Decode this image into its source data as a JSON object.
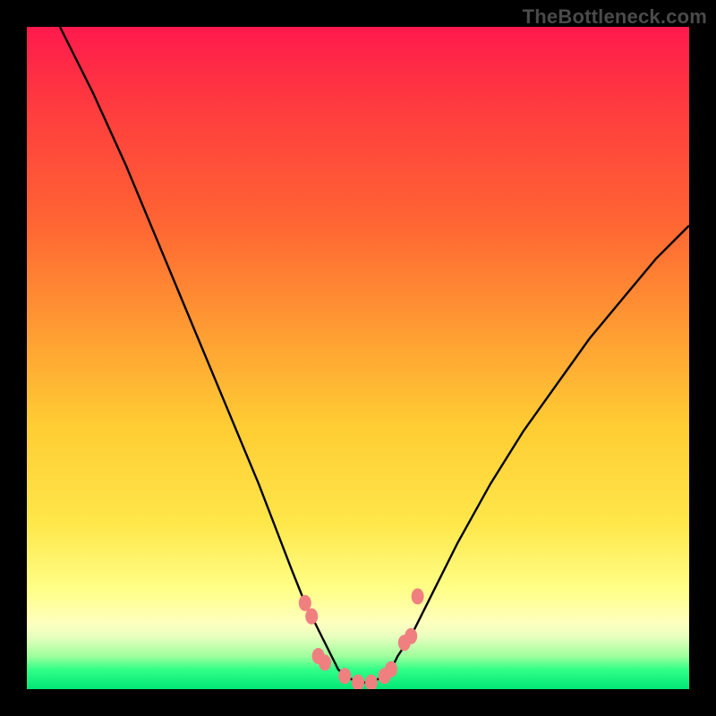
{
  "watermark": "TheBottleneck.com",
  "chart_data": {
    "type": "line",
    "title": "",
    "xlabel": "",
    "ylabel": "",
    "xlim": [
      0,
      100
    ],
    "ylim": [
      0,
      100
    ],
    "background_gradient": {
      "top_color": "#ff1a4d",
      "mid_color": "#ffe74a",
      "bottom_color": "#00e676",
      "meaning": "red = high bottleneck, green = low bottleneck"
    },
    "series": [
      {
        "name": "bottleneck-curve",
        "stroke": "#000000",
        "x": [
          5,
          10,
          15,
          20,
          25,
          30,
          35,
          40,
          42,
          44,
          46,
          47,
          48,
          50,
          52,
          54,
          55,
          56,
          58,
          60,
          65,
          70,
          75,
          80,
          85,
          90,
          95,
          100
        ],
        "y": [
          100,
          90,
          79,
          67,
          55,
          43,
          31,
          18,
          13,
          9,
          5,
          3,
          2,
          1,
          1,
          2,
          3,
          5,
          8,
          12,
          22,
          31,
          39,
          46,
          53,
          59,
          65,
          70
        ]
      }
    ],
    "markers": {
      "name": "highlight-dots",
      "color": "#f08080",
      "points": [
        {
          "x": 42,
          "y": 13
        },
        {
          "x": 43,
          "y": 11
        },
        {
          "x": 44,
          "y": 5
        },
        {
          "x": 45,
          "y": 4
        },
        {
          "x": 48,
          "y": 2
        },
        {
          "x": 50,
          "y": 1
        },
        {
          "x": 52,
          "y": 1
        },
        {
          "x": 54,
          "y": 2
        },
        {
          "x": 55,
          "y": 3
        },
        {
          "x": 57,
          "y": 7
        },
        {
          "x": 58,
          "y": 8
        },
        {
          "x": 59,
          "y": 14
        }
      ]
    }
  }
}
